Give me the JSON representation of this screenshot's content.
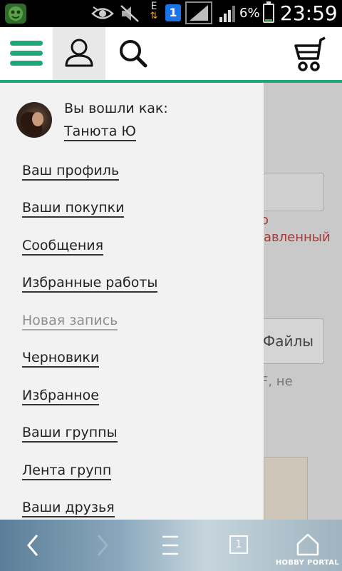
{
  "status_bar": {
    "battery_percent_text": "6%",
    "battery_level": 0.06,
    "time": "23:59",
    "sim_label": "1",
    "data_label": "E",
    "icons": [
      "app-icon",
      "eye-icon",
      "mute-icon",
      "data-icon",
      "sim-icon",
      "signal-icon",
      "signal-icon",
      "battery-icon"
    ]
  },
  "header": {
    "icons": [
      "menu-icon",
      "user-icon",
      "search-icon",
      "cart-icon"
    ],
    "accent_color": "#1ea77d"
  },
  "drawer": {
    "logged_in_label": "Вы вошли как:",
    "username": "Танюта Ю",
    "items": [
      {
        "label": "Ваш профиль",
        "enabled": true
      },
      {
        "label": "Ваши покупки",
        "enabled": true
      },
      {
        "label": "Сообщения",
        "enabled": true
      },
      {
        "label": "Избранные работы",
        "enabled": true
      },
      {
        "label": "Новая запись",
        "enabled": false
      },
      {
        "label": "Черновики",
        "enabled": true
      },
      {
        "label": "Избранное",
        "enabled": true
      },
      {
        "label": "Ваши группы",
        "enabled": true
      },
      {
        "label": "Лента групп",
        "enabled": true
      },
      {
        "label": "Ваши друзья",
        "enabled": true
      }
    ]
  },
  "background_page": {
    "error_line1": "о",
    "error_line2": "авленный",
    "files_button": "Файлы",
    "hint_text": "F, не"
  },
  "browser_bar": {
    "tab_count": "1",
    "icons": [
      "back-icon",
      "forward-icon",
      "menu-icon",
      "tabs-icon",
      "home-icon"
    ],
    "watermark": "HOBBY PORTAL"
  }
}
